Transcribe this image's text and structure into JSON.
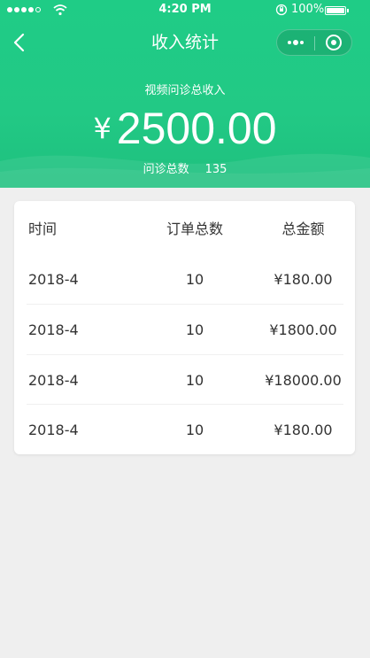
{
  "status_bar": {
    "time": "4:20 PM",
    "battery": "100%"
  },
  "nav": {
    "title": "收入统计"
  },
  "summary": {
    "label": "视频问诊总收入",
    "currency": "¥",
    "amount": "2500.00",
    "consult_label": "问诊总数",
    "consult_count": "135"
  },
  "table": {
    "headers": [
      "时间",
      "订单总数",
      "总金额"
    ],
    "rows": [
      {
        "time": "2018-4",
        "orders": "10",
        "amount": "¥180.00"
      },
      {
        "time": "2018-4",
        "orders": "10",
        "amount": "¥1800.00"
      },
      {
        "time": "2018-4",
        "orders": "10",
        "amount": "¥18000.00"
      },
      {
        "time": "2018-4",
        "orders": "10",
        "amount": "¥180.00"
      }
    ]
  },
  "colors": {
    "brand": "#22c985",
    "background": "#efefef"
  }
}
